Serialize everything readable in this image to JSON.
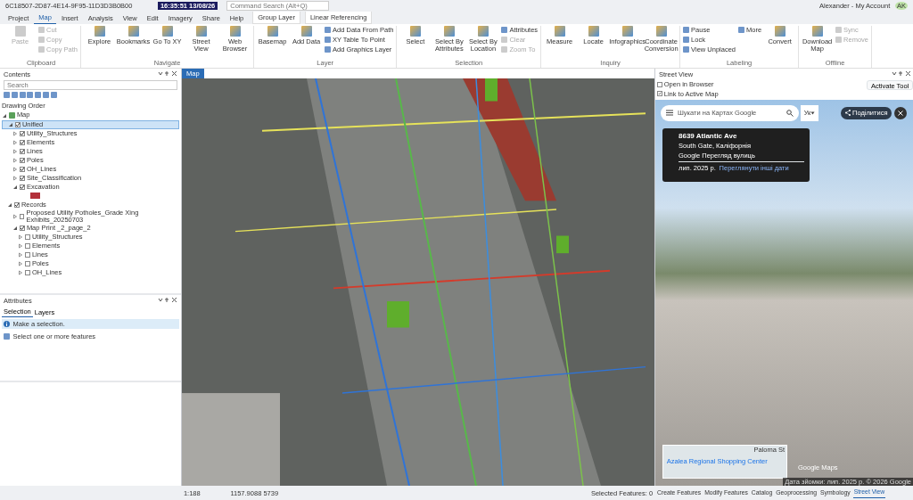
{
  "title_bar": {
    "document": "6C18507-2D87-4E14-9F95-11D3D3B0B00",
    "clock": "16:35:51  13/08/26",
    "search_placeholder": "Command Search (Alt+Q)",
    "account": "Alexander - My Account",
    "initials": "AK"
  },
  "menu_tabs": [
    {
      "label": "Project",
      "kind": "plain",
      "selected": false
    },
    {
      "label": "Map",
      "kind": "plain",
      "selected": true
    },
    {
      "label": "Insert",
      "kind": "plain",
      "selected": false
    },
    {
      "label": "Analysis",
      "kind": "plain",
      "selected": false
    },
    {
      "label": "View",
      "kind": "plain",
      "selected": false
    },
    {
      "label": "Edit",
      "kind": "plain",
      "selected": false
    },
    {
      "label": "Imagery",
      "kind": "plain",
      "selected": false
    },
    {
      "label": "Share",
      "kind": "plain",
      "selected": false
    },
    {
      "label": "Help",
      "kind": "plain",
      "selected": false
    },
    {
      "label": "Group Layer",
      "kind": "contextual",
      "selected": false
    },
    {
      "label": "Linear Referencing",
      "kind": "contextual",
      "selected": false
    }
  ],
  "ribbon": [
    {
      "name": "Clipboard",
      "tools": [
        {
          "label": "Paste",
          "kind": "large",
          "disabled": true
        },
        {
          "label": "Cut",
          "kind": "small",
          "disabled": true
        },
        {
          "label": "Copy",
          "kind": "small",
          "disabled": true
        },
        {
          "label": "Copy Path",
          "kind": "small",
          "disabled": true
        }
      ]
    },
    {
      "name": "Navigate",
      "tools": [
        {
          "label": "Explore",
          "kind": "large",
          "disabled": false
        },
        {
          "label": "Bookmarks",
          "kind": "large",
          "disabled": false
        },
        {
          "label": "Go To XY",
          "kind": "large",
          "disabled": false
        },
        {
          "label": "Street View",
          "kind": "large",
          "disabled": false
        },
        {
          "label": "Web Browser",
          "kind": "large",
          "disabled": false
        }
      ]
    },
    {
      "name": "Layer",
      "tools": [
        {
          "label": "Basemap",
          "kind": "large",
          "disabled": false
        },
        {
          "label": "Add Data",
          "kind": "large",
          "disabled": false
        },
        {
          "label": "Add Data From Path",
          "kind": "small",
          "disabled": false
        },
        {
          "label": "XY Table To Point",
          "kind": "small",
          "disabled": false
        },
        {
          "label": "Add Graphics Layer",
          "kind": "small",
          "disabled": false
        }
      ]
    },
    {
      "name": "Selection",
      "tools": [
        {
          "label": "Select",
          "kind": "large",
          "disabled": false
        },
        {
          "label": "Select By Attributes",
          "kind": "large",
          "disabled": false
        },
        {
          "label": "Select By Location",
          "kind": "large",
          "disabled": false
        },
        {
          "label": "Attributes",
          "kind": "small",
          "disabled": false
        },
        {
          "label": "Clear",
          "kind": "small",
          "disabled": true
        },
        {
          "label": "Zoom To",
          "kind": "small",
          "disabled": true
        }
      ]
    },
    {
      "name": "Inquiry",
      "tools": [
        {
          "label": "Measure",
          "kind": "large",
          "disabled": false
        },
        {
          "label": "Locate",
          "kind": "large",
          "disabled": false
        },
        {
          "label": "Infographics",
          "kind": "large",
          "disabled": false
        },
        {
          "label": "Coordinate Conversion",
          "kind": "large",
          "disabled": false
        }
      ]
    },
    {
      "name": "Labeling",
      "tools": [
        {
          "label": "Pause",
          "kind": "small",
          "disabled": false
        },
        {
          "label": "Lock",
          "kind": "small",
          "disabled": false
        },
        {
          "label": "View Unplaced",
          "kind": "small",
          "disabled": false
        },
        {
          "label": "More",
          "kind": "small",
          "disabled": false
        },
        {
          "label": "Convert",
          "kind": "large",
          "disabled": false
        }
      ]
    },
    {
      "name": "Offline",
      "tools": [
        {
          "label": "Download Map",
          "kind": "large",
          "disabled": false
        },
        {
          "label": "Sync",
          "kind": "small",
          "disabled": true
        },
        {
          "label": "Remove",
          "kind": "small",
          "disabled": true
        }
      ]
    }
  ],
  "contents": {
    "title": "Contents",
    "search_placeholder": "Search",
    "heading": "Drawing Order",
    "tree": [
      {
        "kind": "map",
        "label": "Map",
        "expanded": true,
        "selected": false,
        "children": [
          {
            "kind": "layer",
            "label": "Unified",
            "checked": true,
            "expanded": true,
            "selected": true,
            "children": [
              {
                "kind": "layer",
                "label": "Utility_Structures",
                "checked": true,
                "expanded": false,
                "selected": false
              },
              {
                "kind": "layer",
                "label": "Elements",
                "checked": true,
                "expanded": false,
                "selected": false
              },
              {
                "kind": "layer",
                "label": "Lines",
                "checked": true,
                "expanded": false,
                "selected": false
              },
              {
                "kind": "layer",
                "label": "Poles",
                "checked": true,
                "expanded": false,
                "selected": false
              },
              {
                "kind": "layer",
                "label": "OH_Lines",
                "checked": true,
                "expanded": false,
                "selected": false
              },
              {
                "kind": "layer",
                "label": "Site_Classification",
                "checked": true,
                "expanded": false,
                "selected": false
              },
              {
                "kind": "layer",
                "label": "Excavation",
                "checked": true,
                "expanded": true,
                "selected": false,
                "children": [
                  {
                    "kind": "swatch"
                  }
                ]
              }
            ]
          },
          {
            "kind": "layer",
            "label": "Records",
            "checked": true,
            "expanded": true,
            "selected": false,
            "children": [
              {
                "kind": "layer",
                "label": "Proposed Utility Potholes_Grade Xing Exhibits_20250703",
                "checked": false,
                "expanded": false,
                "selected": false
              },
              {
                "kind": "layer",
                "label": "Map Print _2_page_2",
                "checked": true,
                "expanded": true,
                "selected": false,
                "children": [
                  {
                    "kind": "layer",
                    "label": "Utility_Structures",
                    "checked": false,
                    "expanded": false,
                    "selected": false
                  },
                  {
                    "kind": "layer",
                    "label": "Elements",
                    "checked": false,
                    "expanded": false,
                    "selected": false
                  },
                  {
                    "kind": "layer",
                    "label": "Lines",
                    "checked": false,
                    "expanded": false,
                    "selected": false
                  },
                  {
                    "kind": "layer",
                    "label": "Poles",
                    "checked": false,
                    "expanded": false,
                    "selected": false
                  },
                  {
                    "kind": "layer",
                    "label": "OH_Lines",
                    "checked": false,
                    "expanded": false,
                    "selected": false
                  }
                ]
              }
            ]
          }
        ]
      }
    ]
  },
  "attributes": {
    "title": "Attributes",
    "tabs": [
      {
        "label": "Selection",
        "selected": true
      },
      {
        "label": "Layers",
        "selected": false
      }
    ],
    "message": "Make a selection.",
    "hint": "Select one or more features"
  },
  "map_view": {
    "tab": "Map",
    "scale": "1:188",
    "coordinates": "1157.9088 5739",
    "selected_features": "Selected Features: 0"
  },
  "street_view": {
    "title": "Street View",
    "options": [
      {
        "label": "Open in Browser",
        "checked": false
      },
      {
        "label": "Link to Active Map",
        "checked": true
      }
    ],
    "activate_button": "Activate Tool",
    "google": {
      "search_placeholder": "Шукати на Картах Google",
      "language": "Ук",
      "share": "Поділитися",
      "address": "8639 Atlantic Ave",
      "locality": "South Gate, Каліфорнія",
      "source": "Google Перегляд вулиць",
      "date": "лип. 2025 р.",
      "other_dates": "Переглянути інші дати",
      "minimap_street": "Paloma St",
      "minimap_place": "Azalea Regional Shopping Center",
      "logo": "Google Maps",
      "footer": "Дата зйомки: лип. 2025 р.  © 2026 Google"
    }
  },
  "dock_tabs": [
    {
      "label": "Create Features",
      "selected": false
    },
    {
      "label": "Modify Features",
      "selected": false
    },
    {
      "label": "Catalog",
      "selected": false
    },
    {
      "label": "Geoprocessing",
      "selected": false
    },
    {
      "label": "Symbology",
      "selected": false
    },
    {
      "label": "Street View",
      "selected": true
    }
  ]
}
